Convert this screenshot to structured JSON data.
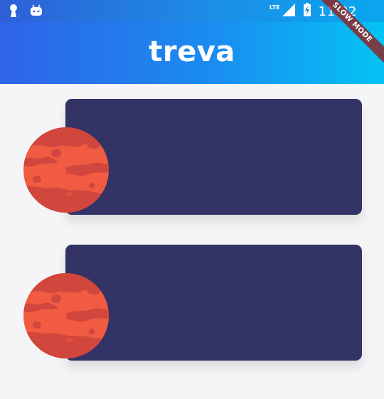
{
  "status_bar": {
    "time": "11:02",
    "network": "LTE",
    "left_icons": [
      "keyhole-notification-icon",
      "android-icon"
    ],
    "right_icons": [
      "signal-icon",
      "battery-charging-icon"
    ]
  },
  "app_bar": {
    "title": "treva",
    "gradient": [
      "#2f63e7",
      "#03c3f3"
    ]
  },
  "debug_banner": "SLOW MODE",
  "cards": [
    {
      "icon": "mars-planet-icon",
      "color": "#333366"
    },
    {
      "icon": "mars-planet-icon",
      "color": "#333366"
    }
  ],
  "colors": {
    "background": "#f5f5f7",
    "card": "#333366",
    "planet_light": "#f05b42",
    "planet_dark": "#d1463d"
  }
}
